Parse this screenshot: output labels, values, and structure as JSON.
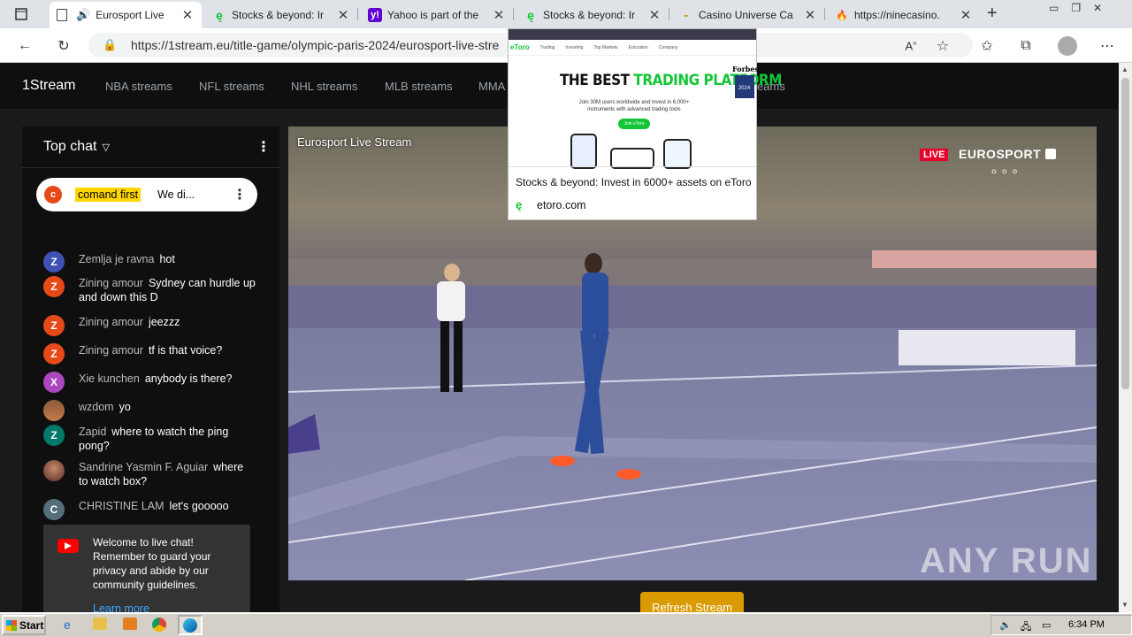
{
  "browser": {
    "tabs": [
      {
        "title": "Eurosport Live",
        "active": true
      },
      {
        "title": "Stocks & beyond: Ir",
        "active": false
      },
      {
        "title": "Yahoo is part of the",
        "active": false
      },
      {
        "title": "Stocks & beyond: Ir",
        "active": false
      },
      {
        "title": "Casino Universe Ca",
        "active": false
      },
      {
        "title": "https://ninecasino.",
        "active": false
      }
    ],
    "url": "https://1stream.eu/title-game/olympic-paris-2024/eurosport-live-stre"
  },
  "site": {
    "brand": "1Stream",
    "nav": [
      "NBA streams",
      "NFL streams",
      "NHL streams",
      "MLB streams",
      "MMA s",
      "eams"
    ]
  },
  "chat": {
    "header": "Top chat",
    "pinned": {
      "author": "comand first",
      "text": "We di...",
      "initial": "c"
    },
    "messages": [
      {
        "initial": "Z",
        "color": "#3f51b5",
        "author": "Zemlja je ravna",
        "text": "hot"
      },
      {
        "initial": "Z",
        "color": "#e64a19",
        "author": "Zining amour",
        "text": "Sydney can hurdle up and down this D"
      },
      {
        "initial": "Z",
        "color": "#e64a19",
        "author": "Zining amour",
        "text": "jeezzz"
      },
      {
        "initial": "Z",
        "color": "#e64a19",
        "author": "Zining amour",
        "text": "tf is that voice?"
      },
      {
        "initial": "X",
        "color": "#ab47bc",
        "author": "Xie kunchen",
        "text": "anybody is there?"
      },
      {
        "initial": "",
        "color": "#8d5a3b",
        "author": "wzdom",
        "text": "yo"
      },
      {
        "initial": "Z",
        "color": "#00796b",
        "author": "Zapid",
        "text": "where to watch the ping pong?"
      },
      {
        "initial": "",
        "color": "#6b3a3a",
        "author": "Sandrine Yasmin F. Aguiar",
        "text": "where to watch box?"
      },
      {
        "initial": "C",
        "color": "#546e7a",
        "author": "CHRISTINE LAM",
        "text": "let's gooooo"
      }
    ],
    "welcome": "Welcome to live chat! Remember to guard your privacy and abide by our community guidelines.",
    "learn_more": "Learn more"
  },
  "video": {
    "title": "Eurosport Live Stream",
    "live_badge": "LIVE",
    "channel": "EUROSPORT",
    "watermark": "ANY RUN"
  },
  "ad": {
    "headline_top": "THE BEST",
    "headline_accent": "TRADING PLATFORM",
    "sub": "Join 30M users worldwide and invest in 6,000+ instruments with advanced trading tools",
    "cta": "Join eToro",
    "badge": "Forbes",
    "badge_year": "2024",
    "nav": [
      "Trading",
      "Investing",
      "Top Markets",
      "Education",
      "Company"
    ],
    "caption": "Stocks & beyond: Invest in 6000+ assets on eToro",
    "domain": "etoro.com"
  },
  "refresh": "Refresh Stream",
  "taskbar": {
    "start": "Start",
    "time": "6:34 PM"
  }
}
